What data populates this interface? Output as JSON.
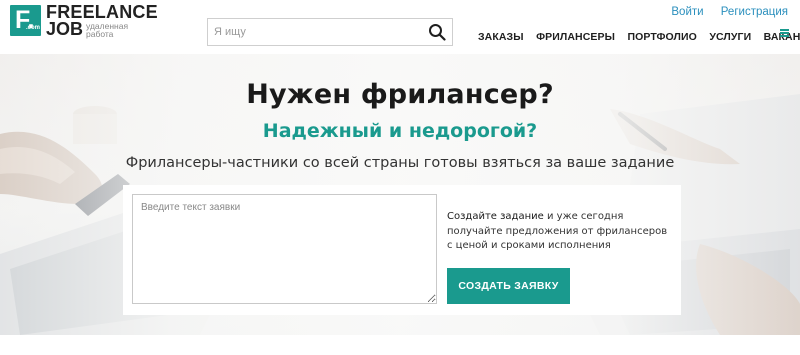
{
  "header": {
    "logo": {
      "letter": "F.",
      "domain": ".com",
      "line1": "FREELANCE",
      "line2": "JOB",
      "tagline": "удаленная работа"
    },
    "search": {
      "placeholder": "Я ищу",
      "value": "",
      "icon": "search-icon"
    },
    "auth": {
      "login": "Войти",
      "register": "Регистрация"
    },
    "nav": [
      {
        "label": "ЗАКАЗЫ"
      },
      {
        "label": "ФРИЛАНСЕРЫ"
      },
      {
        "label": "ПОРТФОЛИО"
      },
      {
        "label": "УСЛУГИ"
      },
      {
        "label": "ВАКАНСИИ"
      }
    ],
    "menu_icon": "hamburger-menu-icon"
  },
  "hero": {
    "title": "Нужен фрилансер?",
    "subtitle": "Надежный и недорогой?",
    "description": "Фрилансеры-частники со всей страны готовы взяться за ваше задание",
    "form": {
      "textarea_placeholder": "Введите текст заявки",
      "textarea_value": "",
      "info_link": "Создайте задание",
      "info_rest": " и уже сегодня получайте предложения от фрилансеров с ценой и сроками исполнения",
      "submit_label": "СОЗДАТЬ ЗАЯВКУ"
    }
  },
  "colors": {
    "accent": "#1a9a8e",
    "link": "#2a8fbd",
    "text": "#222222"
  }
}
